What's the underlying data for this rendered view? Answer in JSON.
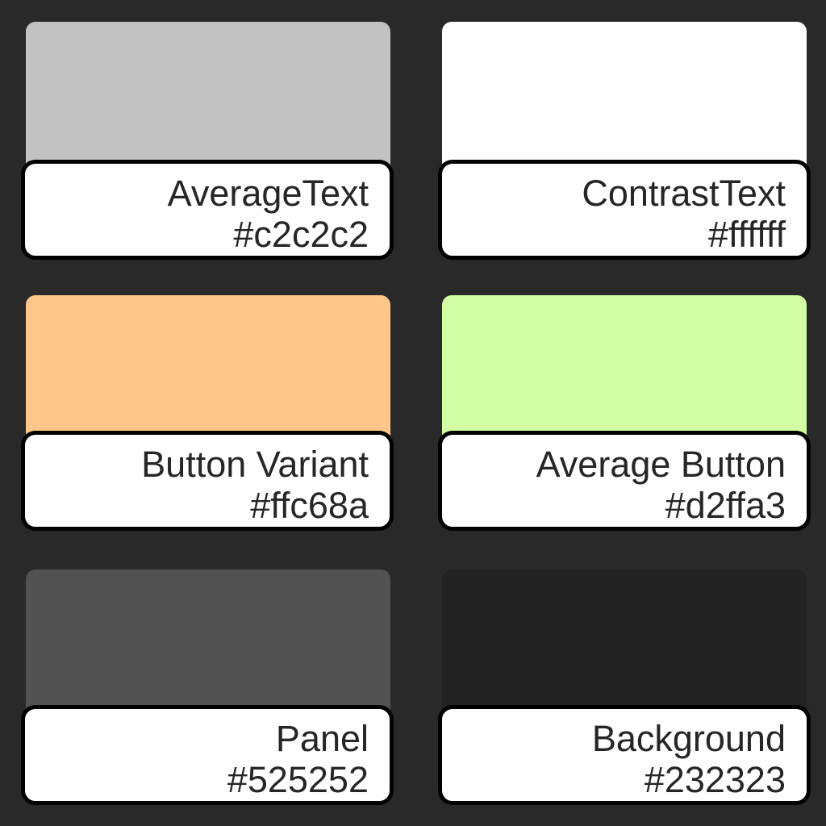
{
  "swatches": [
    {
      "name": "AverageText",
      "hex": "#c2c2c2",
      "color": "#c2c2c2"
    },
    {
      "name": "ContrastText",
      "hex": "#ffffff",
      "color": "#ffffff"
    },
    {
      "name": "Button Variant",
      "hex": "#ffc68a",
      "color": "#ffc68a"
    },
    {
      "name": "Average Button",
      "hex": "#d2ffa3",
      "color": "#d2ffa3"
    },
    {
      "name": "Panel",
      "hex": "#525252",
      "color": "#525252"
    },
    {
      "name": "Background",
      "hex": "#232323",
      "color": "#232323"
    }
  ]
}
